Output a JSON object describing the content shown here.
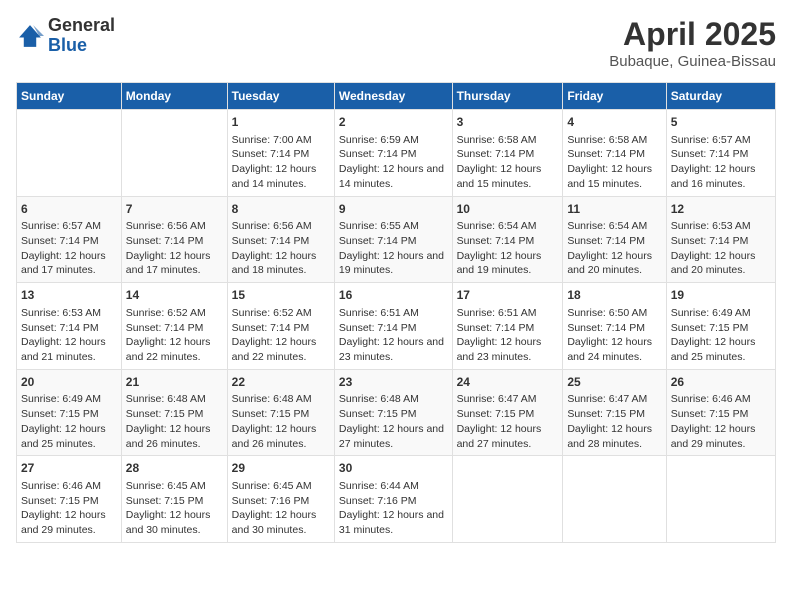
{
  "header": {
    "logo_general": "General",
    "logo_blue": "Blue",
    "title": "April 2025",
    "subtitle": "Bubaque, Guinea-Bissau"
  },
  "days_of_week": [
    "Sunday",
    "Monday",
    "Tuesday",
    "Wednesday",
    "Thursday",
    "Friday",
    "Saturday"
  ],
  "weeks": [
    [
      {
        "day": "",
        "info": ""
      },
      {
        "day": "",
        "info": ""
      },
      {
        "day": "1",
        "sunrise": "Sunrise: 7:00 AM",
        "sunset": "Sunset: 7:14 PM",
        "daylight": "Daylight: 12 hours and 14 minutes."
      },
      {
        "day": "2",
        "sunrise": "Sunrise: 6:59 AM",
        "sunset": "Sunset: 7:14 PM",
        "daylight": "Daylight: 12 hours and 14 minutes."
      },
      {
        "day": "3",
        "sunrise": "Sunrise: 6:58 AM",
        "sunset": "Sunset: 7:14 PM",
        "daylight": "Daylight: 12 hours and 15 minutes."
      },
      {
        "day": "4",
        "sunrise": "Sunrise: 6:58 AM",
        "sunset": "Sunset: 7:14 PM",
        "daylight": "Daylight: 12 hours and 15 minutes."
      },
      {
        "day": "5",
        "sunrise": "Sunrise: 6:57 AM",
        "sunset": "Sunset: 7:14 PM",
        "daylight": "Daylight: 12 hours and 16 minutes."
      }
    ],
    [
      {
        "day": "6",
        "sunrise": "Sunrise: 6:57 AM",
        "sunset": "Sunset: 7:14 PM",
        "daylight": "Daylight: 12 hours and 17 minutes."
      },
      {
        "day": "7",
        "sunrise": "Sunrise: 6:56 AM",
        "sunset": "Sunset: 7:14 PM",
        "daylight": "Daylight: 12 hours and 17 minutes."
      },
      {
        "day": "8",
        "sunrise": "Sunrise: 6:56 AM",
        "sunset": "Sunset: 7:14 PM",
        "daylight": "Daylight: 12 hours and 18 minutes."
      },
      {
        "day": "9",
        "sunrise": "Sunrise: 6:55 AM",
        "sunset": "Sunset: 7:14 PM",
        "daylight": "Daylight: 12 hours and 19 minutes."
      },
      {
        "day": "10",
        "sunrise": "Sunrise: 6:54 AM",
        "sunset": "Sunset: 7:14 PM",
        "daylight": "Daylight: 12 hours and 19 minutes."
      },
      {
        "day": "11",
        "sunrise": "Sunrise: 6:54 AM",
        "sunset": "Sunset: 7:14 PM",
        "daylight": "Daylight: 12 hours and 20 minutes."
      },
      {
        "day": "12",
        "sunrise": "Sunrise: 6:53 AM",
        "sunset": "Sunset: 7:14 PM",
        "daylight": "Daylight: 12 hours and 20 minutes."
      }
    ],
    [
      {
        "day": "13",
        "sunrise": "Sunrise: 6:53 AM",
        "sunset": "Sunset: 7:14 PM",
        "daylight": "Daylight: 12 hours and 21 minutes."
      },
      {
        "day": "14",
        "sunrise": "Sunrise: 6:52 AM",
        "sunset": "Sunset: 7:14 PM",
        "daylight": "Daylight: 12 hours and 22 minutes."
      },
      {
        "day": "15",
        "sunrise": "Sunrise: 6:52 AM",
        "sunset": "Sunset: 7:14 PM",
        "daylight": "Daylight: 12 hours and 22 minutes."
      },
      {
        "day": "16",
        "sunrise": "Sunrise: 6:51 AM",
        "sunset": "Sunset: 7:14 PM",
        "daylight": "Daylight: 12 hours and 23 minutes."
      },
      {
        "day": "17",
        "sunrise": "Sunrise: 6:51 AM",
        "sunset": "Sunset: 7:14 PM",
        "daylight": "Daylight: 12 hours and 23 minutes."
      },
      {
        "day": "18",
        "sunrise": "Sunrise: 6:50 AM",
        "sunset": "Sunset: 7:14 PM",
        "daylight": "Daylight: 12 hours and 24 minutes."
      },
      {
        "day": "19",
        "sunrise": "Sunrise: 6:49 AM",
        "sunset": "Sunset: 7:15 PM",
        "daylight": "Daylight: 12 hours and 25 minutes."
      }
    ],
    [
      {
        "day": "20",
        "sunrise": "Sunrise: 6:49 AM",
        "sunset": "Sunset: 7:15 PM",
        "daylight": "Daylight: 12 hours and 25 minutes."
      },
      {
        "day": "21",
        "sunrise": "Sunrise: 6:48 AM",
        "sunset": "Sunset: 7:15 PM",
        "daylight": "Daylight: 12 hours and 26 minutes."
      },
      {
        "day": "22",
        "sunrise": "Sunrise: 6:48 AM",
        "sunset": "Sunset: 7:15 PM",
        "daylight": "Daylight: 12 hours and 26 minutes."
      },
      {
        "day": "23",
        "sunrise": "Sunrise: 6:48 AM",
        "sunset": "Sunset: 7:15 PM",
        "daylight": "Daylight: 12 hours and 27 minutes."
      },
      {
        "day": "24",
        "sunrise": "Sunrise: 6:47 AM",
        "sunset": "Sunset: 7:15 PM",
        "daylight": "Daylight: 12 hours and 27 minutes."
      },
      {
        "day": "25",
        "sunrise": "Sunrise: 6:47 AM",
        "sunset": "Sunset: 7:15 PM",
        "daylight": "Daylight: 12 hours and 28 minutes."
      },
      {
        "day": "26",
        "sunrise": "Sunrise: 6:46 AM",
        "sunset": "Sunset: 7:15 PM",
        "daylight": "Daylight: 12 hours and 29 minutes."
      }
    ],
    [
      {
        "day": "27",
        "sunrise": "Sunrise: 6:46 AM",
        "sunset": "Sunset: 7:15 PM",
        "daylight": "Daylight: 12 hours and 29 minutes."
      },
      {
        "day": "28",
        "sunrise": "Sunrise: 6:45 AM",
        "sunset": "Sunset: 7:15 PM",
        "daylight": "Daylight: 12 hours and 30 minutes."
      },
      {
        "day": "29",
        "sunrise": "Sunrise: 6:45 AM",
        "sunset": "Sunset: 7:16 PM",
        "daylight": "Daylight: 12 hours and 30 minutes."
      },
      {
        "day": "30",
        "sunrise": "Sunrise: 6:44 AM",
        "sunset": "Sunset: 7:16 PM",
        "daylight": "Daylight: 12 hours and 31 minutes."
      },
      {
        "day": "",
        "info": ""
      },
      {
        "day": "",
        "info": ""
      },
      {
        "day": "",
        "info": ""
      }
    ]
  ]
}
